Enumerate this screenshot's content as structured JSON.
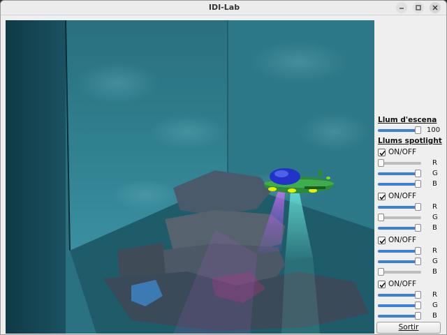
{
  "window": {
    "title": "IDI-Lab"
  },
  "panel": {
    "scene_light": {
      "title": "Llum d'escena",
      "value": 100,
      "value_text": "100"
    },
    "spotlights": {
      "title": "Llums spotlight",
      "lights": [
        {
          "enabled": true,
          "label": "ON/OFF",
          "channels": [
            {
              "name": "R",
              "level": 0.0
            },
            {
              "name": "G",
              "level": 1.0
            },
            {
              "name": "B",
              "level": 1.0
            }
          ]
        },
        {
          "enabled": true,
          "label": "ON/OFF",
          "channels": [
            {
              "name": "R",
              "level": 1.0
            },
            {
              "name": "G",
              "level": 0.0
            },
            {
              "name": "B",
              "level": 1.0
            }
          ]
        },
        {
          "enabled": true,
          "label": "ON/OFF",
          "channels": [
            {
              "name": "R",
              "level": 1.0
            },
            {
              "name": "G",
              "level": 1.0
            },
            {
              "name": "B",
              "level": 0.0
            }
          ]
        },
        {
          "enabled": true,
          "label": "ON/OFF",
          "channels": [
            {
              "name": "R",
              "level": 1.0
            },
            {
              "name": "G",
              "level": 1.0
            },
            {
              "name": "B",
              "level": 1.0
            }
          ]
        }
      ]
    },
    "exit_button": {
      "label": "Sortir"
    }
  },
  "colors": {
    "accent": "#3d7fd9",
    "water": "#2f7f8c",
    "submarine_hull": "#2d8a3a",
    "submarine_dome": "#2233c8"
  }
}
